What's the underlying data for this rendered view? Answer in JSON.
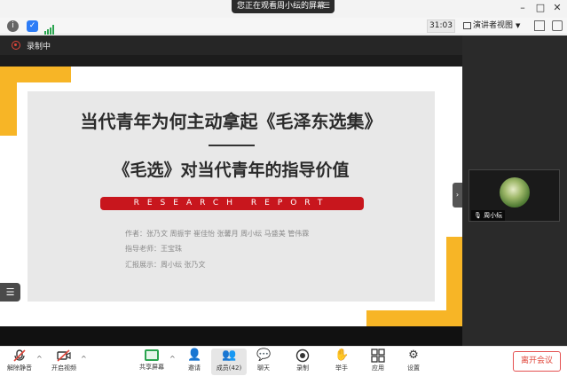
{
  "titlebar": {
    "share_notice": "您正在观看周小纭的屏幕",
    "menu_icon": "menu-lines-icon",
    "minimize_icon": "minimize-icon",
    "maximize_icon": "maximize-icon",
    "close_icon": "close-icon",
    "minimize": "–",
    "maximize": "□",
    "close": "✕"
  },
  "toolbar": {
    "info_icon": "info-icon",
    "shield_icon": "shield-icon",
    "signal_icon": "signal-icon",
    "timer": "31:03",
    "speaker_view": "演讲者视图",
    "fullscreen_icon": "fullscreen-icon",
    "window_icon": "window-icon"
  },
  "recording": {
    "label": "录制中",
    "color": "#e0463a"
  },
  "slide": {
    "title_line1": "当代青年为何主动拿起《毛泽东选集》",
    "title_line2": "《毛选》对当代青年的指导价值",
    "banner": "RESEARCH REPORT",
    "authors": "作者：张乃文  周振宇  崔佳怡  张馨月  周小纭  马盛美  管伟霖",
    "advisor": "指导老师：王宝珠",
    "presenters": "汇报展示：周小纭  张乃文",
    "accent_gold": "#f7b526",
    "accent_red": "#c8161d"
  },
  "gallery": {
    "participant_name": "周小纭",
    "mic_icon": "mic-icon",
    "collapse_icon": "chevron-right-icon"
  },
  "controls": {
    "unmute": "解除静音",
    "start_video": "开启视频",
    "share_screen": "共享屏幕",
    "invite": "邀请",
    "members": "成员(42)",
    "chat": "聊天",
    "record": "录制",
    "raise_hand": "举手",
    "apps": "应用",
    "settings": "设置",
    "leave": "离开会议",
    "leave_color": "#e0463a",
    "share_color": "#2aa44f"
  }
}
